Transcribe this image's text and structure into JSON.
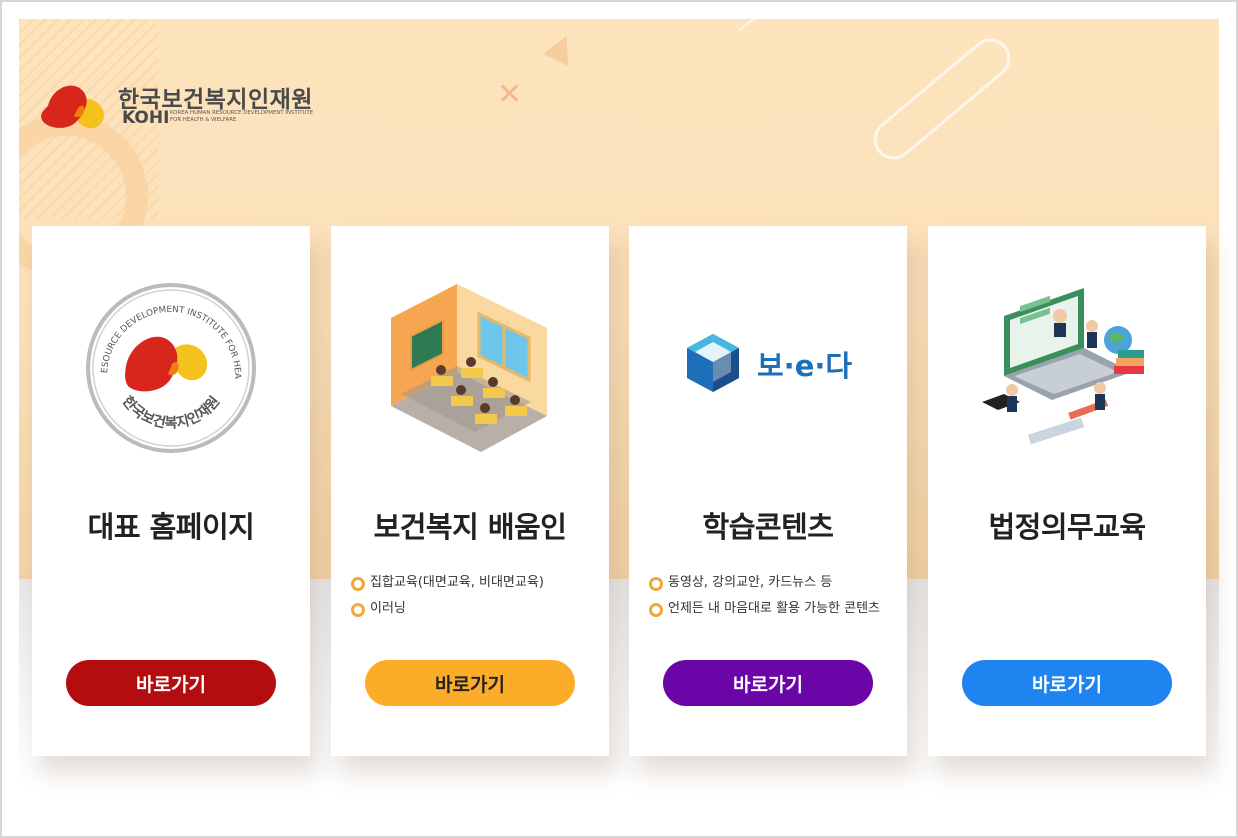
{
  "logo": {
    "name_ko": "한국보건복지인재원",
    "name_en": "KOHI",
    "tagline_line1": "KOREA HUMAN RESOURCE DEVELOPMENT INSTITUTE",
    "tagline_line2": "FOR HEALTH & WELFARE",
    "icon": "kohi-logo-icon"
  },
  "cards": [
    {
      "title": "대표 홈페이지",
      "icon": "kohi-seal-icon",
      "seal_text_top": "KOREA HUMAN RESOURCE DEVELOPMENT INSTITUTE FOR HEALTH & WELFARE",
      "seal_text_bottom": "한국보건복지인재원",
      "bullets": [],
      "button_label": "바로가기",
      "button_color": "#b30d10"
    },
    {
      "title": "보건복지 배움인",
      "icon": "classroom-illustration-icon",
      "bullets": [
        "집합교육(대면교육, 비대면교육)",
        "이러닝"
      ],
      "button_label": "바로가기",
      "button_color": "#fbac29"
    },
    {
      "title": "학습콘텐츠",
      "icon": "bo-e-da-logo-icon",
      "brand_text": "보·e·다",
      "bullets": [
        "동영상, 강의교안, 카드뉴스 등",
        "언제든 내 마음대로 활용 가능한 콘텐츠"
      ],
      "button_label": "바로가기",
      "button_color": "#6a05a8"
    },
    {
      "title": "법정의무교육",
      "icon": "online-learning-illustration-icon",
      "bullets": [],
      "button_label": "바로가기",
      "button_color": "#1f84f0"
    }
  ]
}
